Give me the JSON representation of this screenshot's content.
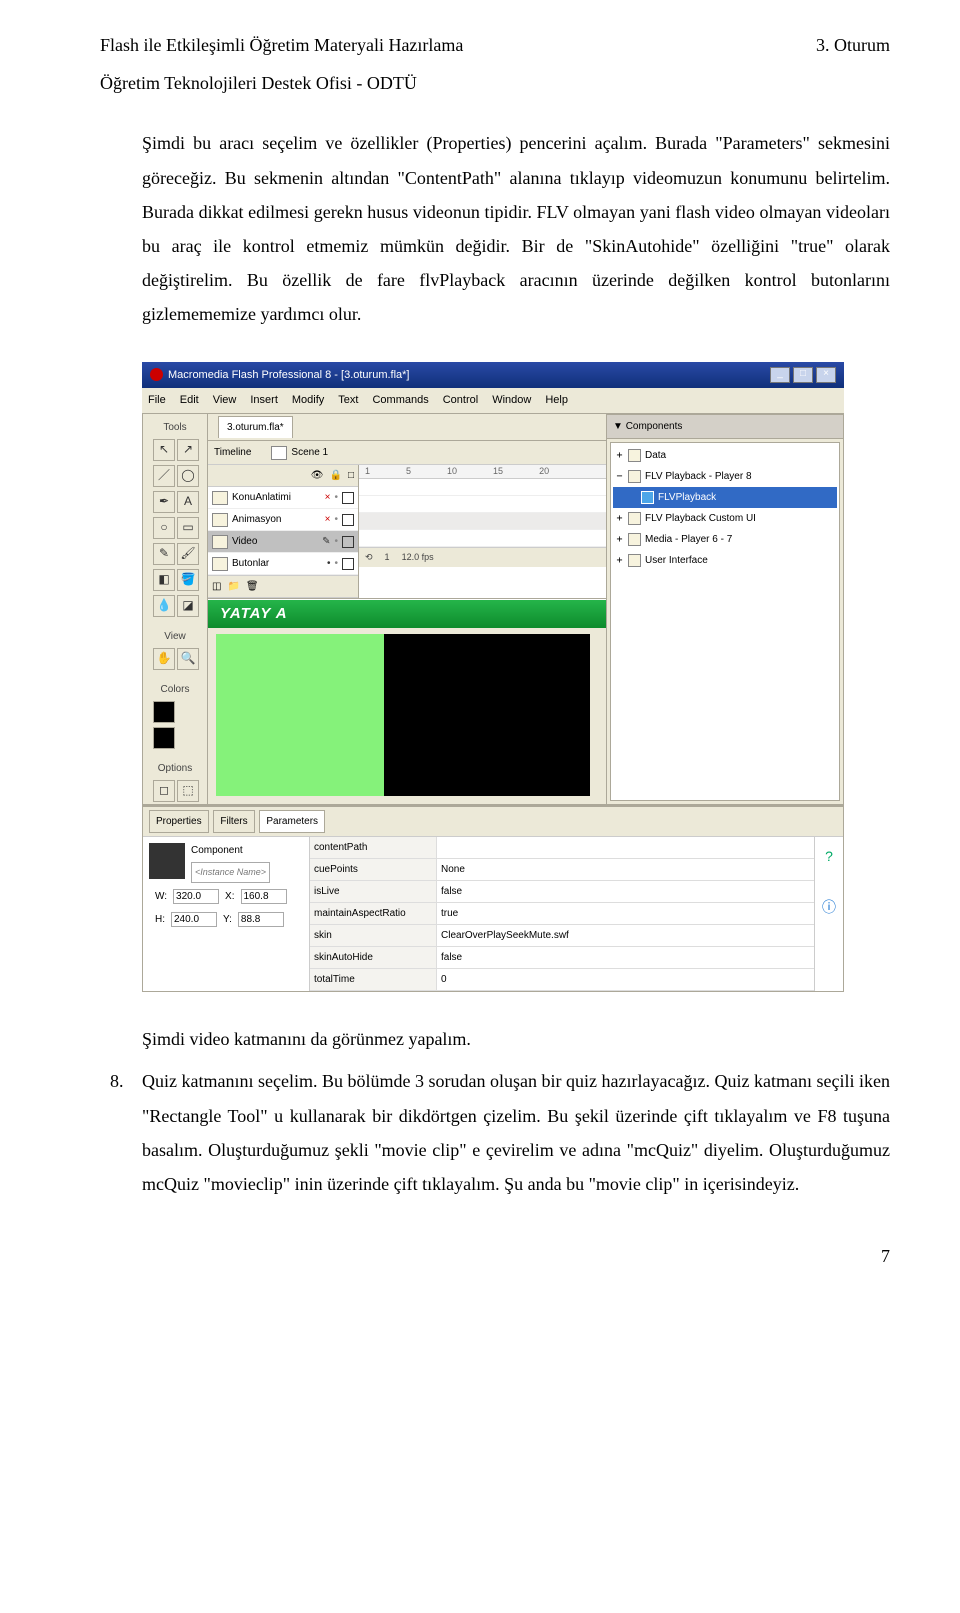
{
  "header": {
    "left": "Flash ile Etkileşimli Öğretim Materyali Hazırlama",
    "right": "3. Oturum",
    "sub": "Öğretim Teknolojileri Destek Ofisi - ODTÜ"
  },
  "para1": "Şimdi bu aracı seçelim ve özellikler (Properties) pencerini açalım. Burada \"Parameters\" sekmesini göreceğiz. Bu sekmenin altından \"ContentPath\" alanına tıklayıp videomuzun konumunu belirtelim. Burada dikkat edilmesi gerekn husus videonun tipidir. FLV olmayan yani flash video olmayan videoları bu araç ile kontrol etmemiz mümkün değidir. Bir de \"SkinAutohide\" özelliğini \"true\" olarak değiştirelim. Bu özellik de fare flvPlayback aracının üzerinde değilken kontrol butonlarını gizlemememize yardımcı olur.",
  "shot": {
    "title": "Macromedia Flash Professional 8 - [3.oturum.fla*]",
    "menus": [
      "File",
      "Edit",
      "View",
      "Insert",
      "Modify",
      "Text",
      "Commands",
      "Control",
      "Window",
      "Help"
    ],
    "toolsHeader": "Tools",
    "viewHeader": "View",
    "colorsHeader": "Colors",
    "optionsHeader": "Options",
    "filetab": "3.oturum.fla*",
    "timeline": "Timeline",
    "scene": "Scene 1",
    "layers": [
      {
        "name": "KonuAnlatimi",
        "sel": false
      },
      {
        "name": "Animasyon",
        "sel": false
      },
      {
        "name": "Video",
        "sel": true
      },
      {
        "name": "Butonlar",
        "sel": false
      }
    ],
    "ruler": [
      "1",
      "5",
      "10",
      "15",
      "20"
    ],
    "footer": {
      "frame": "1",
      "fps": "12.0 fps"
    },
    "yatay": "YATAY A",
    "compPanel": "Components",
    "tree": [
      {
        "pm": "+",
        "label": "Data",
        "lv": 0
      },
      {
        "pm": "−",
        "label": "FLV Playback - Player 8",
        "lv": 0
      },
      {
        "pm": "",
        "label": "FLVPlayback",
        "lv": 1,
        "sel": true
      },
      {
        "pm": "+",
        "label": "FLV Playback Custom UI",
        "lv": 0
      },
      {
        "pm": "+",
        "label": "Media - Player 6 - 7",
        "lv": 0
      },
      {
        "pm": "+",
        "label": "User Interface",
        "lv": 0
      }
    ],
    "propTabs": [
      "Properties",
      "Filters",
      "Parameters"
    ],
    "component": "Component",
    "instance": "<Instance Name>",
    "wh": {
      "Wl": "W:",
      "W": "320.0",
      "Xl": "X:",
      "X": "160.8",
      "Hl": "H:",
      "H": "240.0",
      "Yl": "Y:",
      "Y": "88.8"
    },
    "params": [
      {
        "k": "contentPath",
        "v": ""
      },
      {
        "k": "cuePoints",
        "v": "None"
      },
      {
        "k": "isLive",
        "v": "false"
      },
      {
        "k": "maintainAspectRatio",
        "v": "true"
      },
      {
        "k": "skin",
        "v": "ClearOverPlaySeekMute.swf"
      },
      {
        "k": "skinAutoHide",
        "v": "false"
      },
      {
        "k": "totalTime",
        "v": "0"
      }
    ]
  },
  "under": "Şimdi video katmanını da görünmez yapalım.",
  "item8": {
    "num": "8.",
    "text": "Quiz katmanını seçelim. Bu bölümde 3 sorudan oluşan bir quiz hazırlayacağız. Quiz katmanı seçili iken \"Rectangle Tool\" u kullanarak bir dikdörtgen çizelim. Bu şekil üzerinde çift tıklayalım ve F8 tuşuna basalım. Oluşturduğumuz şekli \"movie clip\" e çevirelim ve adına \"mcQuiz\" diyelim. Oluşturduğumuz mcQuiz \"movieclip\" inin üzerinde çift tıklayalım. Şu anda bu \"movie clip\" in içerisindeyiz."
  },
  "page": "7"
}
